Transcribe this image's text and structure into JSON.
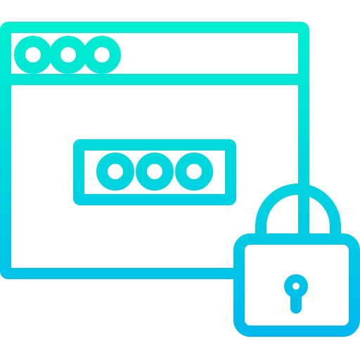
{
  "icon": {
    "name": "secure-password-browser-icon",
    "gradient": {
      "top_color": "#00F0D0",
      "bottom_color": "#00B8EE"
    },
    "parts": {
      "browser_window": "browser-window-icon",
      "window_dots": "window-control-dots-icon",
      "password_field": "masked-password-field-icon",
      "padlock": "padlock-icon",
      "keyhole": "keyhole-icon"
    }
  }
}
